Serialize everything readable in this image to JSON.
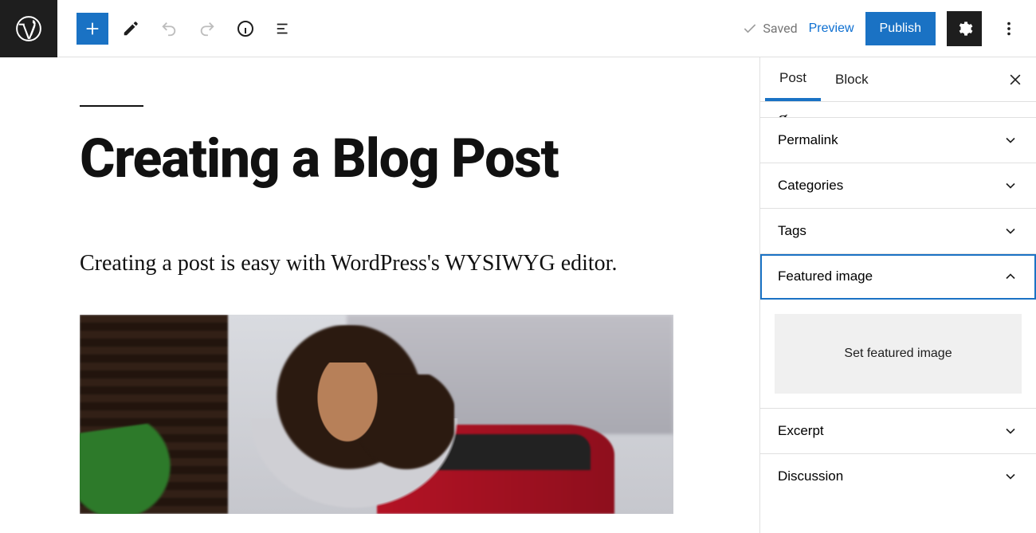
{
  "topbar": {
    "saved_label": "Saved",
    "preview_label": "Preview",
    "publish_label": "Publish"
  },
  "editor": {
    "title": "Creating a Blog Post",
    "paragraph": "Creating a post is easy with WordPress's WYSIWYG editor."
  },
  "sidebar": {
    "tabs": {
      "post": "Post",
      "block": "Block"
    },
    "panels": {
      "permalink": "Permalink",
      "categories": "Categories",
      "tags": "Tags",
      "featured_image": "Featured image",
      "set_featured_label": "Set featured image",
      "excerpt": "Excerpt",
      "discussion": "Discussion"
    }
  }
}
